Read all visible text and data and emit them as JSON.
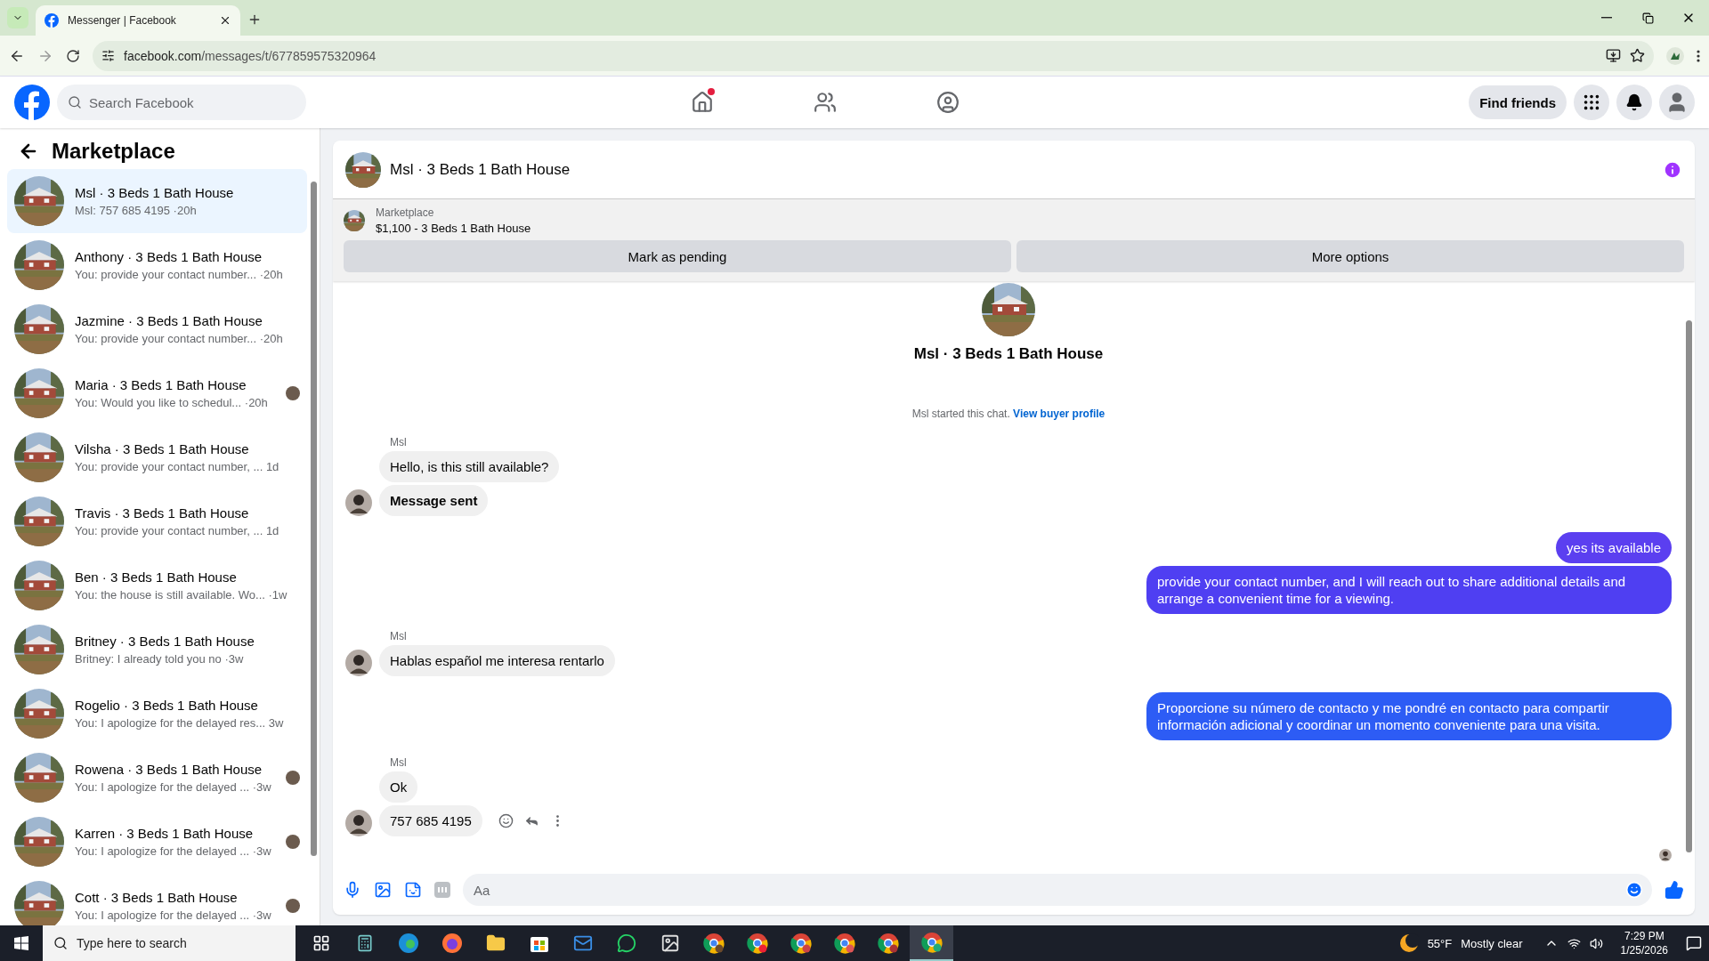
{
  "browser": {
    "tab_title": "Messenger | Facebook",
    "url_host": "facebook.com",
    "url_path": "/messages/t/677859575320964"
  },
  "header": {
    "search_placeholder": "Search Facebook",
    "find_friends": "Find friends",
    "home_badge": true
  },
  "sidebar": {
    "title": "Marketplace",
    "items": [
      {
        "name": "Msl · 3 Beds 1 Bath House",
        "preview": "Msl: 757 685 4195",
        "time": "·20h",
        "selected": true,
        "read_receipt": false
      },
      {
        "name": "Anthony · 3 Beds 1 Bath House",
        "preview": "You: provide your contact number...",
        "time": "·20h",
        "selected": false,
        "read_receipt": false
      },
      {
        "name": "Jazmine · 3 Beds 1 Bath House",
        "preview": "You: provide your contact number...",
        "time": "·20h",
        "selected": false,
        "read_receipt": false
      },
      {
        "name": "Maria · 3 Beds 1 Bath House",
        "preview": "You: Would you like to schedul...",
        "time": "·20h",
        "selected": false,
        "read_receipt": true
      },
      {
        "name": "Vilsha · 3 Beds 1 Bath House",
        "preview": "You: provide your contact number, ...",
        "time": "1d",
        "selected": false,
        "read_receipt": false
      },
      {
        "name": "Travis · 3 Beds 1 Bath House",
        "preview": "You: provide your contact number, ...",
        "time": "1d",
        "selected": false,
        "read_receipt": false
      },
      {
        "name": "Ben · 3 Beds 1 Bath House",
        "preview": "You: the house is still available. Wo...",
        "time": "·1w",
        "selected": false,
        "read_receipt": false
      },
      {
        "name": "Britney · 3 Beds 1 Bath House",
        "preview": "Britney: I already told you no",
        "time": "·3w",
        "selected": false,
        "read_receipt": false
      },
      {
        "name": "Rogelio · 3 Beds 1 Bath House",
        "preview": "You: I apologize for the delayed res...",
        "time": "3w",
        "selected": false,
        "read_receipt": false
      },
      {
        "name": "Rowena · 3 Beds 1 Bath House",
        "preview": "You: I apologize for the delayed ...",
        "time": "·3w",
        "selected": false,
        "read_receipt": true
      },
      {
        "name": "Karren · 3 Beds 1 Bath House",
        "preview": "You: I apologize for the delayed ...",
        "time": "·3w",
        "selected": false,
        "read_receipt": true
      },
      {
        "name": "Cott · 3 Beds 1 Bath House",
        "preview": "You: I apologize for the delayed ...",
        "time": "·3w",
        "selected": false,
        "read_receipt": true
      }
    ]
  },
  "chat": {
    "title": "Msl · 3 Beds 1 Bath House",
    "listing_label": "Marketplace",
    "listing_title": "$1,100 - 3 Beds 1 Bath House",
    "buttons": [
      "Mark as pending",
      "More options"
    ],
    "intro_name": "Msl · 3 Beds 1 Bath House",
    "notice": "Msl started this chat.",
    "notice_link": "View buyer profile",
    "messages": [
      {
        "kind": "received",
        "sender": "Msl",
        "bubbles": [
          {
            "text": "Hello, is this still available?",
            "bold": false,
            "hovered": false
          },
          {
            "text": "Message sent",
            "bold": true,
            "hovered": false
          }
        ]
      },
      {
        "kind": "sent",
        "bubbles": [
          {
            "text": "yes its available",
            "color": "#5b3ff0"
          },
          {
            "text": "provide your contact number, and I will reach out to share additional details and arrange a convenient time for a viewing.",
            "color": "#4f3ff2"
          }
        ]
      },
      {
        "kind": "received",
        "sender": "Msl",
        "bubbles": [
          {
            "text": "Hablas español me interesa rentarlo",
            "bold": false,
            "hovered": false
          }
        ]
      },
      {
        "kind": "sent",
        "bubbles": [
          {
            "text": "Proporcione su número de contacto y me pondré en contacto para compartir información adicional y coordinar un momento conveniente para una visita.",
            "color": "#2d5cf5"
          }
        ]
      },
      {
        "kind": "received",
        "sender": "Msl",
        "bubbles": [
          {
            "text": "Ok",
            "bold": false,
            "hovered": false
          },
          {
            "text": "757 685 4195",
            "bold": false,
            "hovered": true
          }
        ]
      }
    ],
    "composer_placeholder": "Aa"
  },
  "taskbar": {
    "search_placeholder": "Type here to search",
    "temperature": "55°F",
    "weather": "Mostly clear",
    "time": "7:29 PM",
    "date": "1/25/2026"
  }
}
